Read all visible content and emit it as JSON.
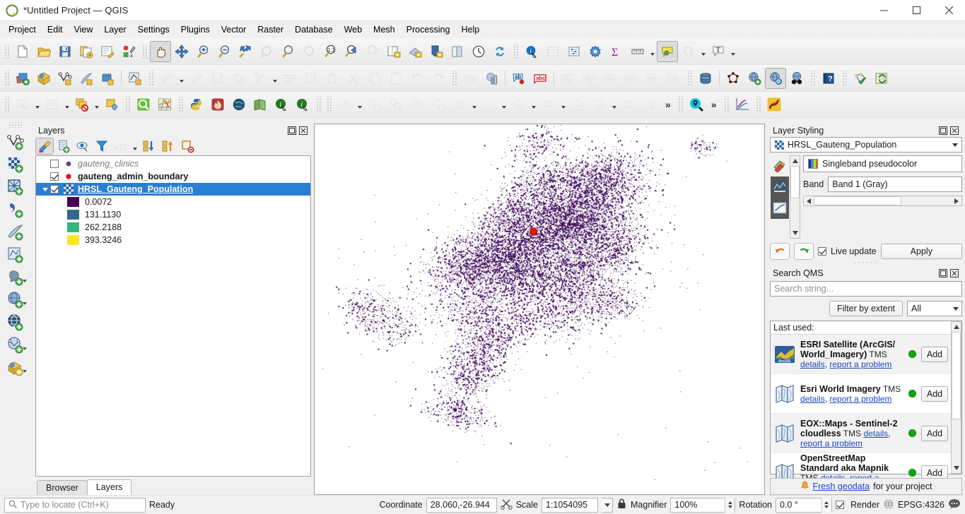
{
  "window": {
    "title": "*Untitled Project — QGIS",
    "app_icon": "qgis-logo-icon",
    "minimize": "minimize-icon",
    "maximize": "maximize-icon",
    "close": "close-icon"
  },
  "menu": [
    {
      "label": "Project"
    },
    {
      "label": "Edit"
    },
    {
      "label": "View"
    },
    {
      "label": "Layer"
    },
    {
      "label": "Settings"
    },
    {
      "label": "Plugins"
    },
    {
      "label": "Vector"
    },
    {
      "label": "Raster"
    },
    {
      "label": "Database"
    },
    {
      "label": "Web"
    },
    {
      "label": "Mesh"
    },
    {
      "label": "Processing"
    },
    {
      "label": "Help"
    }
  ],
  "layers_panel": {
    "title": "Layers",
    "float_icon": "float-panel-icon",
    "close_icon": "close-panel-icon",
    "toolbar": [
      {
        "name": "open-layer-styling-panel",
        "active": true
      },
      {
        "name": "add-group"
      },
      {
        "name": "manage-map-themes"
      },
      {
        "name": "filter-legend-by-map-content"
      },
      {
        "name": "filter-legend-by-expression",
        "disabled": true
      },
      {
        "name": "expand-all"
      },
      {
        "name": "collapse-all"
      },
      {
        "name": "remove-layer-or-group"
      }
    ],
    "items": [
      {
        "name": "gauteng_clinics",
        "checked": false,
        "style": "italic",
        "symbol": "purple-point"
      },
      {
        "name": "gauteng_admin_boundary",
        "checked": true,
        "style": "bold",
        "symbol": "red-point"
      },
      {
        "name": "HRSL_Gauteng_Population",
        "checked": true,
        "style": "selected",
        "symbol": "raster-checker",
        "expanded": true
      }
    ],
    "legend": [
      {
        "value": "0.0072",
        "color": "#440154"
      },
      {
        "value": "131.1130",
        "color": "#31688E"
      },
      {
        "value": "262.2188",
        "color": "#35B779"
      },
      {
        "value": "393.3246",
        "color": "#FDE725"
      }
    ],
    "tabs": [
      {
        "label": "Browser",
        "active": false
      },
      {
        "label": "Layers",
        "active": true
      }
    ]
  },
  "layer_styling": {
    "title": "Layer Styling",
    "float_icon": "float-panel-icon",
    "close_icon": "close-panel-icon",
    "layer_combo": "HRSL_Gauteng_Population",
    "renderer": "Singleband pseudocolor",
    "band_label": "Band",
    "band_value": "Band 1 (Gray)",
    "undo_icon": "undo-icon",
    "redo_icon": "redo-icon",
    "live_update_label": "Live update",
    "live_update_checked": true,
    "apply_label": "Apply"
  },
  "search_qms": {
    "title": "Search QMS",
    "float_icon": "float-panel-icon",
    "close_icon": "close-panel-icon",
    "search_placeholder": "Search string...",
    "filter_button": "Filter by extent",
    "filter_value": "All",
    "list_header": "Last used:",
    "services": [
      {
        "title": "ESRI Satellite (ArcGIS/ World_Imagery)",
        "protocol": "TMS",
        "details_label": "details",
        "report_label": "report a problem",
        "status_color": "#13a613",
        "add_label": "Add",
        "icon": "esri-arcgis-icon"
      },
      {
        "title": "Esri World Imagery",
        "protocol": "TMS",
        "details_label": "details",
        "report_label": "report a problem",
        "status_color": "#13a613",
        "add_label": "Add",
        "icon": "map-sheet-icon"
      },
      {
        "title": "EOX::Maps - Sentinel-2 cloudless",
        "protocol": "TMS",
        "details_label": "details",
        "report_label": "report a problem",
        "status_color": "#13a613",
        "add_label": "Add",
        "icon": "map-sheet-icon"
      },
      {
        "title": "OpenStreetMap Standard aka Mapnik",
        "protocol": "TMS",
        "details_label": "details",
        "report_label": "report a problem",
        "status_color": "#13a613",
        "add_label": "Add",
        "icon": "map-sheet-icon"
      }
    ],
    "fresh_bell_icon": "bell-icon",
    "fresh_link": "Fresh geodata",
    "fresh_suffix": "for your project"
  },
  "status_bar": {
    "locate_placeholder": "Type to locate (Ctrl+K)",
    "locate_icon": "search-icon",
    "message": "Ready",
    "coordinate_label": "Coordinate",
    "coordinate_value": "28.060,-26.944",
    "toggle_extents_icon": "toggle-extents-icon",
    "scale_label": "Scale",
    "scale_value": "1:1054095",
    "lock_icon": "lock-icon",
    "magnifier_label": "Magnifier",
    "magnifier_value": "100%",
    "rotation_label": "Rotation",
    "rotation_value": "0.0 °",
    "render_label": "Render",
    "render_checked": true,
    "crs_icon": "globe-icon",
    "crs_value": "EPSG:4326",
    "messages_icon": "messages-icon"
  },
  "map": {
    "background": "#ffffff",
    "raster_color": "#4c1a66",
    "marker_color": "#ee1111",
    "marker_label": "gauteng_admin_boundary-point"
  }
}
